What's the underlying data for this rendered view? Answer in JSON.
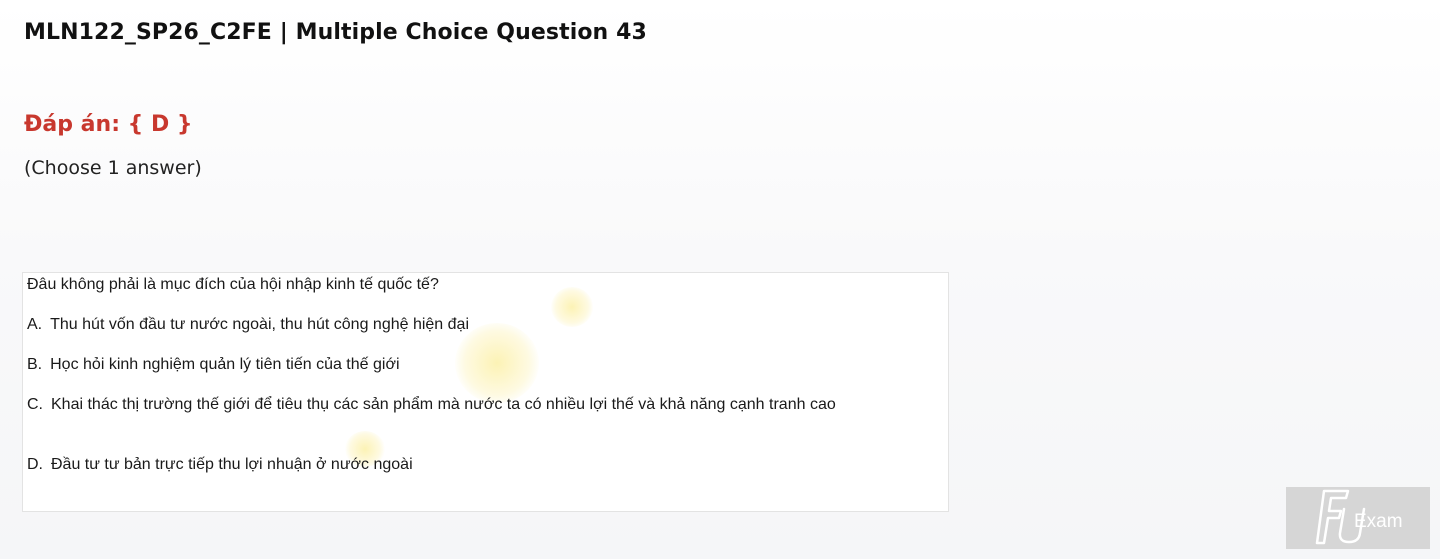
{
  "header": {
    "title": "MLN122_SP26_C2FE | Multiple Choice Question 43"
  },
  "answer": {
    "label": "Đáp án: { D }"
  },
  "instruction": {
    "text": "(Choose 1 answer)"
  },
  "question": {
    "stem": "Đâu không phải là mục đích của hội nhập kinh tế quốc tế?",
    "options": [
      {
        "letter": "A.",
        "text": "Thu hút vốn đầu tư nước ngoài, thu hút công nghệ hiện đại"
      },
      {
        "letter": "B.",
        "text": "Học hỏi kinh nghiệm quản lý tiên tiến của thế giới"
      },
      {
        "letter": "C.",
        "text": "Khai thác thị trường thế giới để tiêu thụ các sản phẩm mà nước ta có nhiều lợi thế và khả năng cạnh tranh cao"
      },
      {
        "letter": "D.",
        "text": "Đầu tư tư bản trực tiếp thu lợi nhuận ở nước ngoài"
      }
    ]
  },
  "logo": {
    "text": "Exam",
    "mark": "FU",
    "color": "#ffffff",
    "background": "#d6d6d6"
  },
  "colors": {
    "answer_accent": "#c8382e"
  }
}
